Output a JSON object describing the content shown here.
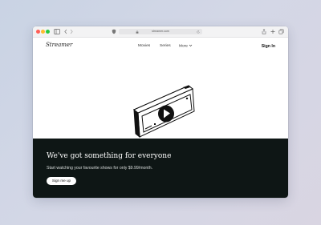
{
  "browser": {
    "url": "streamer.com"
  },
  "nav": {
    "logo": "Streamer",
    "links": [
      "Movies",
      "Series",
      "More"
    ],
    "signin": "Sign In"
  },
  "hero": {
    "headline": "We've got something for everyone",
    "subtext": "Start watching your favourite shows for only $9.99/month.",
    "cta": "Sign me up"
  },
  "icons": [
    "sidebar-icon",
    "back-icon",
    "forward-icon",
    "privacy-shield-icon",
    "lock-icon",
    "reload-icon",
    "share-icon",
    "new-tab-icon",
    "tabs-overview-icon",
    "chevron-down-icon",
    "play-icon"
  ],
  "colors": {
    "banner": "#0e1615",
    "accent": "#ffffff"
  }
}
